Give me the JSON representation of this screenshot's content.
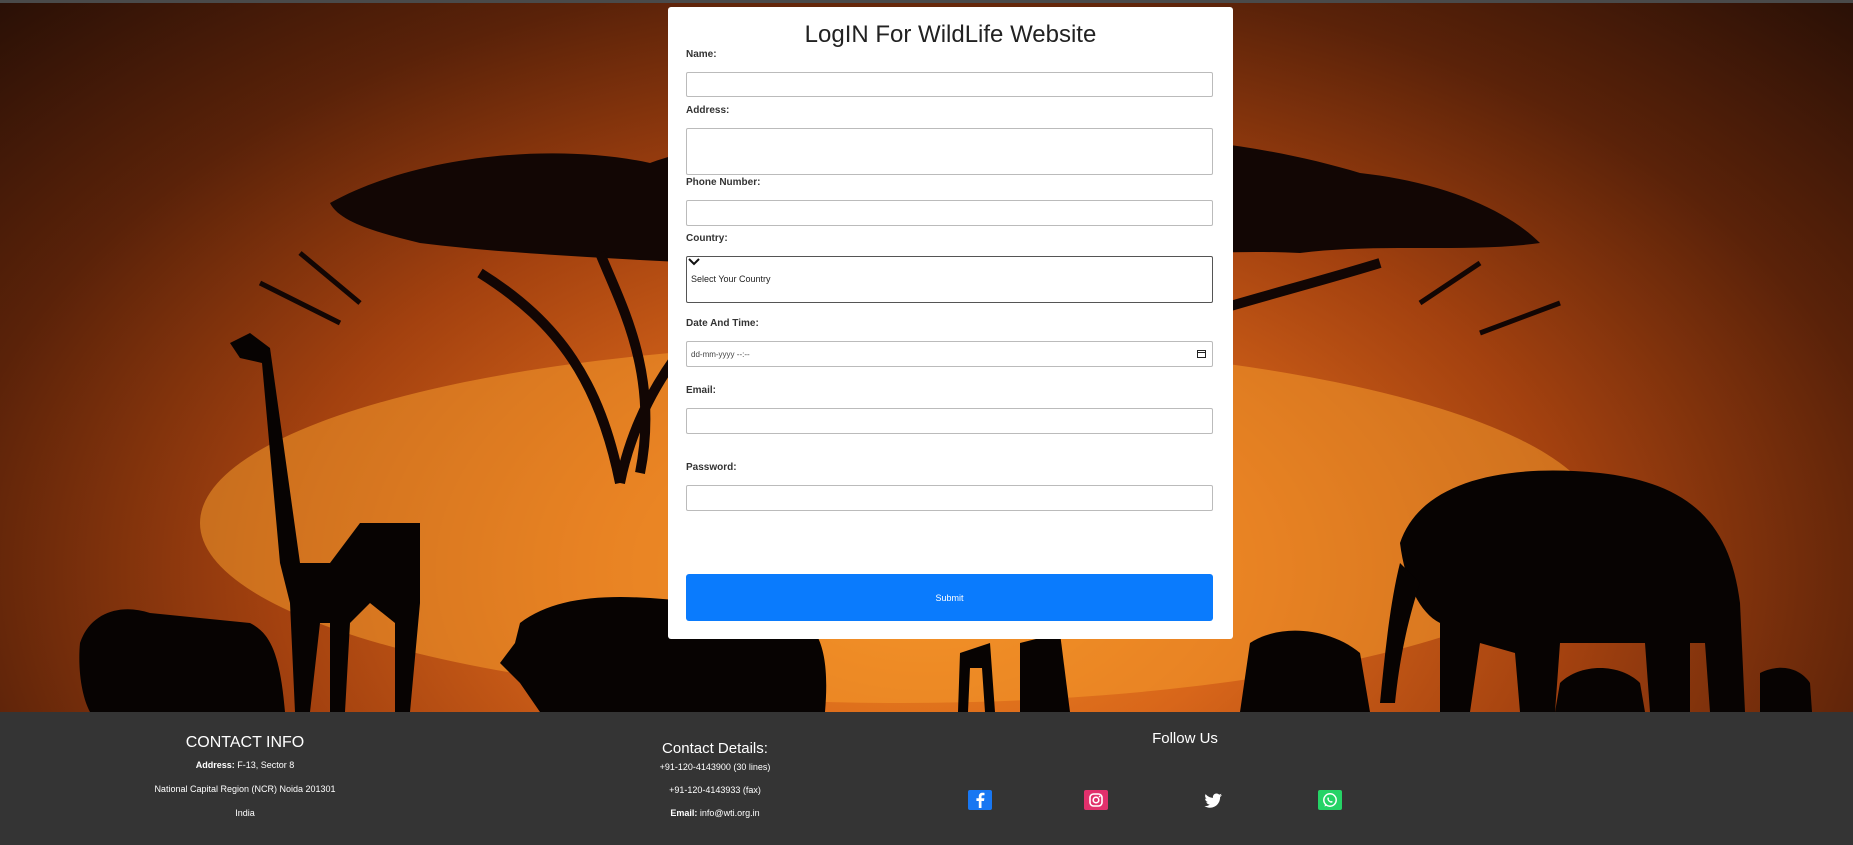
{
  "form": {
    "title": "LogIN For WildLife Website",
    "name_label": "Name:",
    "address_label": "Address:",
    "phone_label": "Phone Number:",
    "country_label": "Country:",
    "country_selected": "Select Your Country",
    "datetime_label": "Date And Time:",
    "datetime_placeholder": "dd-mm-yyyy --:--",
    "email_label": "Email:",
    "password_label": "Password:",
    "submit_label": "Submit"
  },
  "footer": {
    "contact_info": {
      "heading": "CONTACT INFO",
      "address_label": "Address:",
      "address_value": " F-13, Sector 8",
      "region": "National Capital Region (NCR) Noida 201301",
      "country": "India"
    },
    "contact_details": {
      "heading": "Contact Details:",
      "phone1": "+91-120-4143900 (30 lines)",
      "phone2": "+91-120-4143933 (fax)",
      "email_label": "Email:",
      "email_value": " info@wti.org.in"
    },
    "follow": {
      "heading": "Follow Us",
      "icons": [
        "facebook-icon",
        "instagram-icon",
        "twitter-icon",
        "whatsapp-icon"
      ]
    }
  },
  "colors": {
    "submit_bg": "#0a7bfd",
    "footer_bg": "#343434",
    "facebook": "#1877f2",
    "instagram": "#e1306c",
    "whatsapp": "#25d366"
  }
}
